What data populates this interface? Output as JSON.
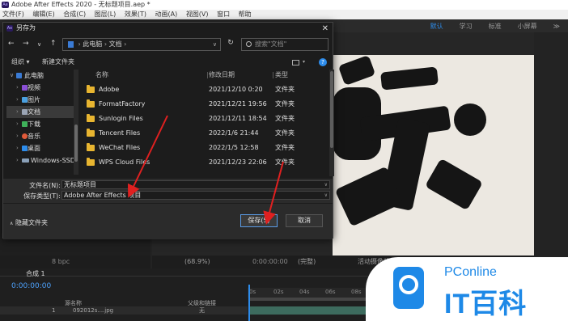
{
  "app": {
    "title": "Adobe After Effects 2020 - 无标题项目.aep *",
    "logo_text": "Ae",
    "menu": [
      "文件(F)",
      "编辑(E)",
      "合成(C)",
      "图层(L)",
      "效果(T)",
      "动画(A)",
      "视图(V)",
      "窗口",
      "帮助"
    ],
    "workspaces": [
      "默认",
      "学习",
      "标准",
      "小屏幕"
    ],
    "active_workspace": "默认",
    "accent": "#2d8ceb"
  },
  "viewer": {
    "zoom": "(68.9%)",
    "resolution": "(完整)",
    "camera": "活动摄像机",
    "time": "0:00:00:00",
    "bpc": "8 bpc"
  },
  "timeline": {
    "tab": "合成 1",
    "current_time": "0:00:00:00",
    "col_source": "源名称",
    "col_parent": "父级和链接",
    "parent_value": "无",
    "layer_number": "1",
    "layer_name": "092012s....jpg",
    "ruler_ticks": [
      "0s",
      "02s",
      "04s",
      "06s",
      "08s",
      "10s"
    ]
  },
  "dialog": {
    "title": "另存为",
    "close": "✕",
    "breadcrumb": [
      "此电脑",
      "文档"
    ],
    "search_placeholder": "搜索\"文档\"",
    "organize": "组织 ▾",
    "new_folder": "新建文件夹",
    "tree": [
      {
        "label": "此电脑",
        "icon": "pc-icon",
        "color": "#3a7bd5"
      },
      {
        "label": "视频",
        "icon": "video-folder-icon",
        "color": "#8a4fd6"
      },
      {
        "label": "图片",
        "icon": "pictures-folder-icon",
        "color": "#4aa0e0"
      },
      {
        "label": "文档",
        "icon": "documents-folder-icon",
        "color": "#9aa4b4"
      },
      {
        "label": "下载",
        "icon": "download-icon",
        "color": "#3fb15a"
      },
      {
        "label": "音乐",
        "icon": "music-icon",
        "color": "#e05a3a"
      },
      {
        "label": "桌面",
        "icon": "desktop-icon",
        "color": "#2d8ceb"
      },
      {
        "label": "Windows-SSD",
        "icon": "drive-icon",
        "color": "#8aa0b8"
      }
    ],
    "columns": {
      "name": "名称",
      "modified": "修改日期",
      "type": "类型"
    },
    "files": [
      {
        "name": "Adobe",
        "modified": "2021/12/10 0:20",
        "type": "文件夹"
      },
      {
        "name": "FormatFactory",
        "modified": "2021/12/21 19:56",
        "type": "文件夹"
      },
      {
        "name": "Sunlogin Files",
        "modified": "2021/12/11 18:54",
        "type": "文件夹"
      },
      {
        "name": "Tencent Files",
        "modified": "2022/1/6 21:44",
        "type": "文件夹"
      },
      {
        "name": "WeChat Files",
        "modified": "2022/1/5 12:58",
        "type": "文件夹"
      },
      {
        "name": "WPS Cloud Files",
        "modified": "2021/12/23 22:06",
        "type": "文件夹"
      }
    ],
    "filename_label": "文件名(N):",
    "filename_value": "无标题项目",
    "filetype_label": "保存类型(T):",
    "filetype_value": "Adobe After Effects 项目",
    "hide_folders": "隐藏文件夹",
    "save": "保存(S)",
    "cancel": "取消"
  },
  "watermark": {
    "brand": "PConline",
    "slogan": "IT百科",
    "color": "#1e89e7"
  }
}
